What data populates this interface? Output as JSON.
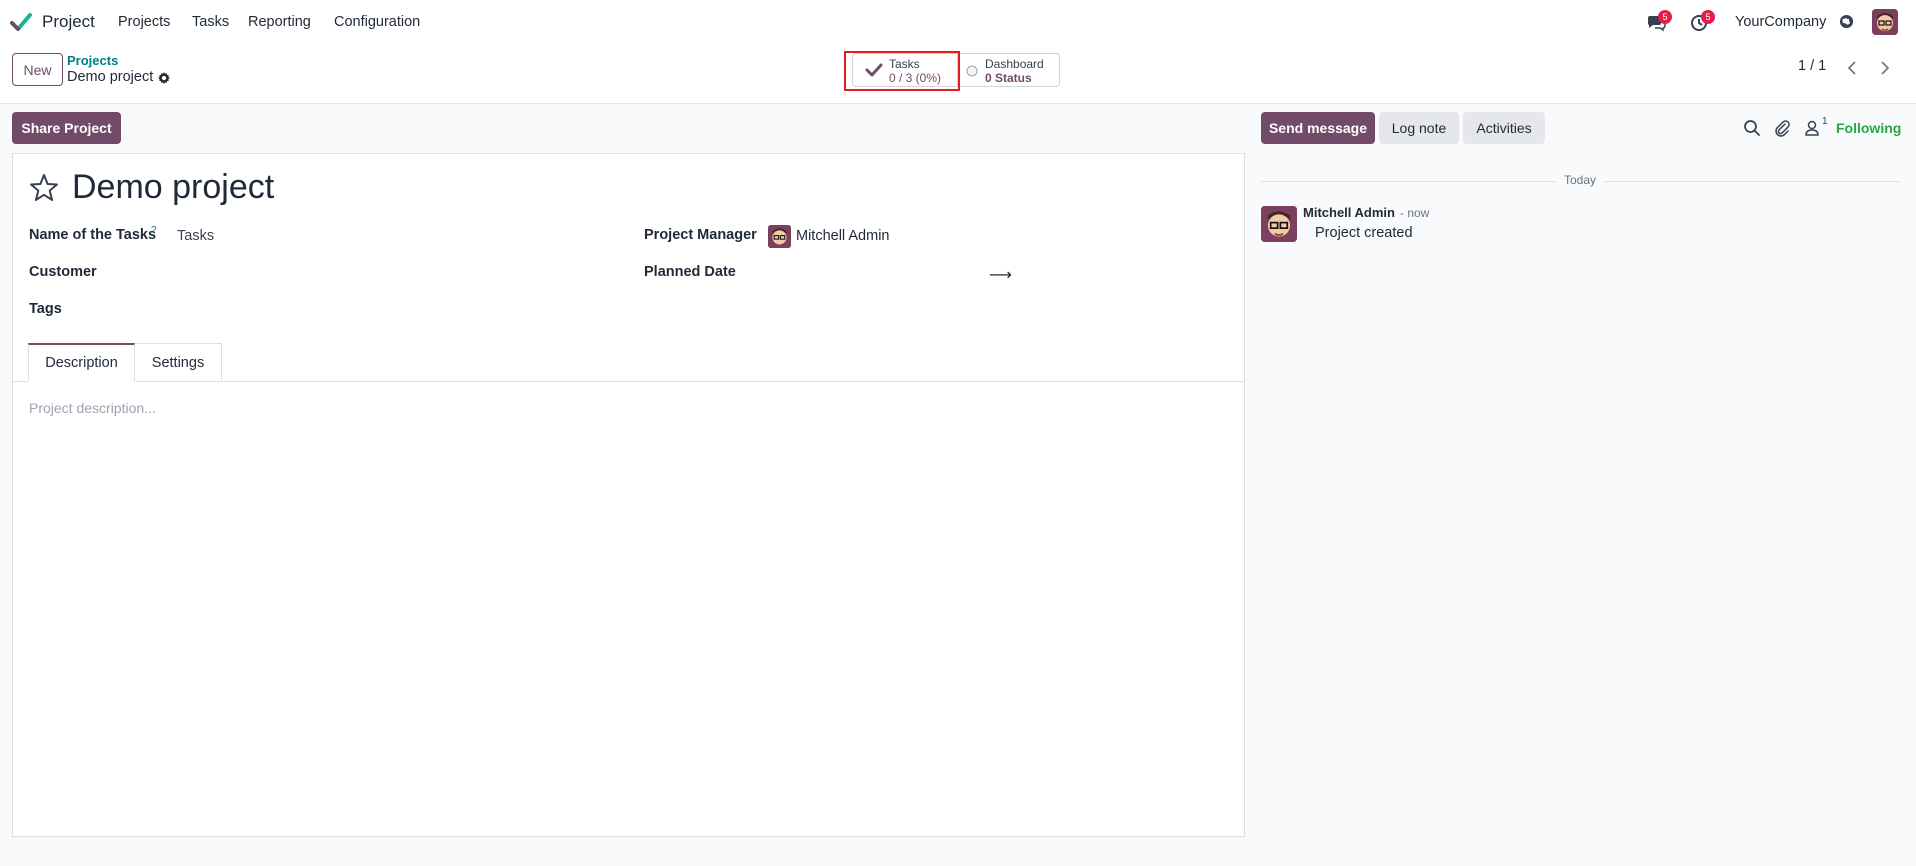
{
  "navbar": {
    "app_name": "Project",
    "menu": [
      "Projects",
      "Tasks",
      "Reporting",
      "Configuration"
    ],
    "messages_badge": "5",
    "activities_badge": "5",
    "company": "YourCompany"
  },
  "control_panel": {
    "new_label": "New",
    "breadcrumb_parent": "Projects",
    "breadcrumb_current": "Demo project",
    "smart_buttons": {
      "tasks_label": "Tasks",
      "tasks_value": "0 / 3 (0%)",
      "dashboard_label": "Dashboard",
      "dashboard_value": "0 Status"
    },
    "pager": "1 / 1"
  },
  "form": {
    "share_label": "Share Project",
    "title": "Demo project",
    "fields": {
      "name_of_tasks_label": "Name of the Tasks",
      "help_marker": "?",
      "name_of_tasks_value": "Tasks",
      "customer_label": "Customer",
      "tags_label": "Tags",
      "project_manager_label": "Project Manager",
      "project_manager_value": "Mitchell Admin",
      "planned_date_label": "Planned Date",
      "planned_date_arrow": "⟶"
    },
    "tabs": [
      "Description",
      "Settings"
    ],
    "description_placeholder": "Project description..."
  },
  "chatter": {
    "send_message": "Send message",
    "log_note": "Log note",
    "activities": "Activities",
    "follower_count": "1",
    "following": "Following",
    "date_separator": "Today",
    "message": {
      "author": "Mitchell Admin",
      "time": "- now",
      "body": "Project created"
    }
  },
  "colors": {
    "primary": "#714B67",
    "link": "#017e84",
    "following": "#28a745",
    "badge": "#e11d48",
    "highlight": "#e11d1d"
  }
}
